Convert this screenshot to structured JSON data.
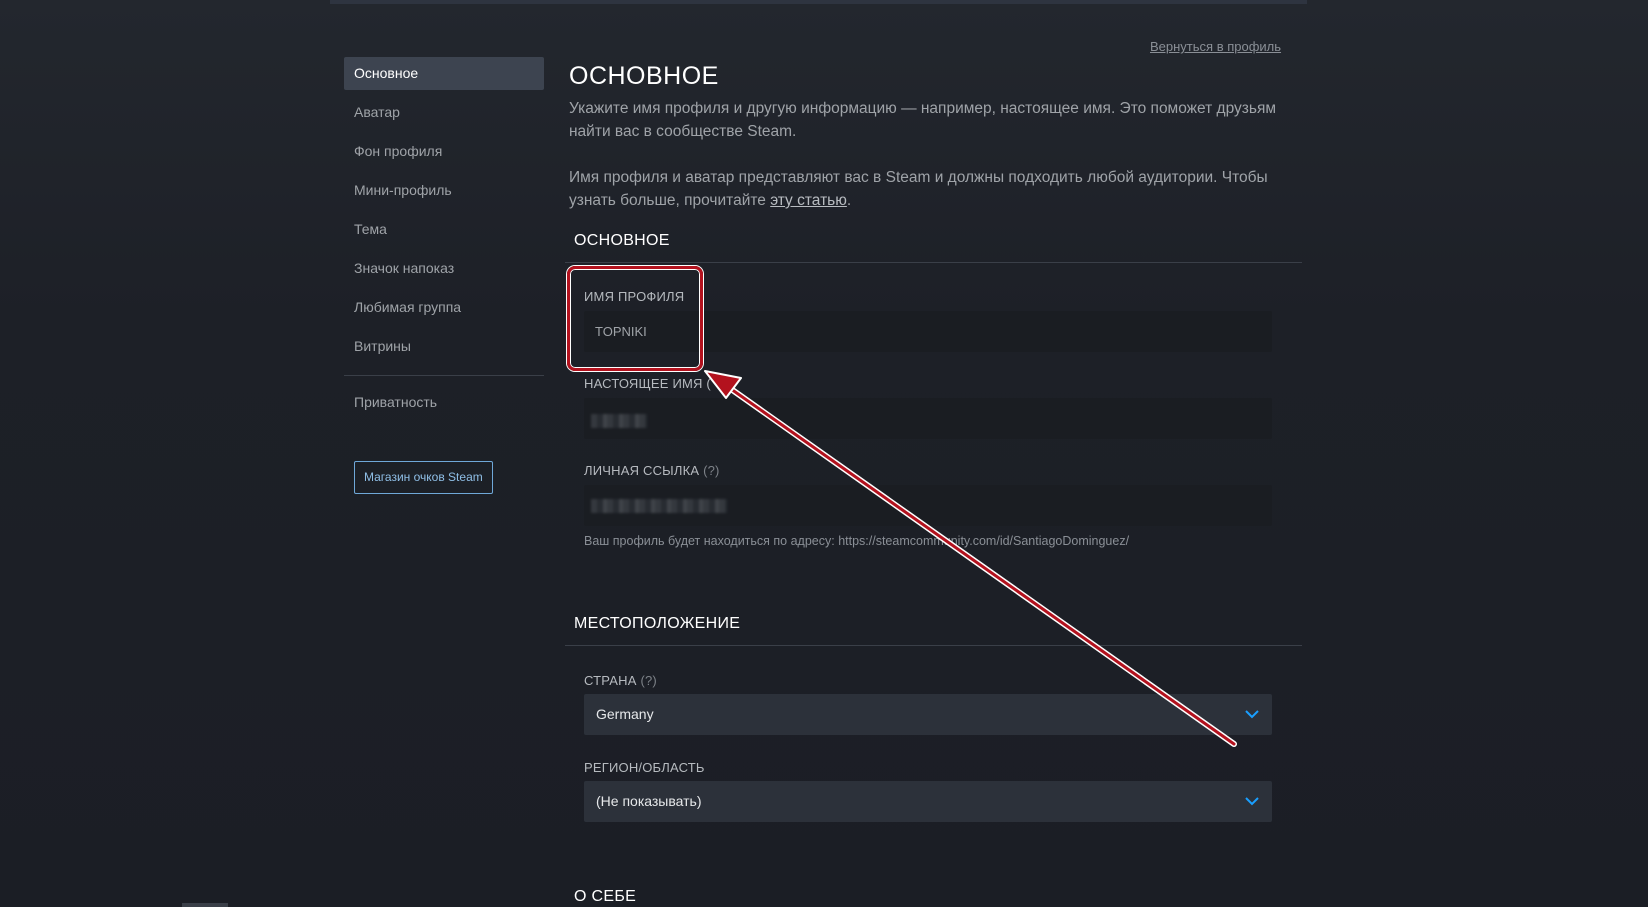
{
  "header": {
    "back_link": "Вернуться в профиль"
  },
  "sidebar": {
    "items": [
      {
        "label": "Основное",
        "active": true
      },
      {
        "label": "Аватар"
      },
      {
        "label": "Фон профиля"
      },
      {
        "label": "Мини-профиль"
      },
      {
        "label": "Тема"
      },
      {
        "label": "Значок напоказ"
      },
      {
        "label": "Любимая группа"
      },
      {
        "label": "Витрины"
      }
    ],
    "privacy_label": "Приватность",
    "points_shop_button": "Магазин очков Steam"
  },
  "main": {
    "title": "ОСНОВНОЕ",
    "desc1": "Укажите имя профиля и другую информацию — например, настоящее имя. Это поможет друзьям найти вас в сообществе Steam.",
    "desc2_text": "Имя профиля и аватар представляют вас в Steam и должны подходить любой аудитории. Чтобы узнать больше, прочитайте",
    "desc2_link": "эту статью",
    "desc2_end": "."
  },
  "basic_section": {
    "header": "ОСНОВНОЕ",
    "profile_name_label": "ИМЯ ПРОФИЛЯ",
    "profile_name_value": "TOPNIKI",
    "real_name_label": "НАСТОЯЩЕЕ ИМЯ (",
    "custom_url_label": "ЛИЧНАЯ ССЫЛКА",
    "help_mark": "(?)",
    "url_hint": "Ваш профиль будет находиться по адресу: https://steamcommunity.com/id/SantiagoDominguez/"
  },
  "location_section": {
    "header": "МЕСТОПОЛОЖЕНИЕ",
    "country_label": "СТРАНА",
    "country_help": "(?)",
    "country_value": "Germany",
    "region_label": "РЕГИОН/ОБЛАСТЬ",
    "region_value": "(Не показывать)"
  },
  "about_section": {
    "header": "О СЕБЕ"
  },
  "colors": {
    "accent": "#1a9fff",
    "highlight": "#b3121e"
  }
}
